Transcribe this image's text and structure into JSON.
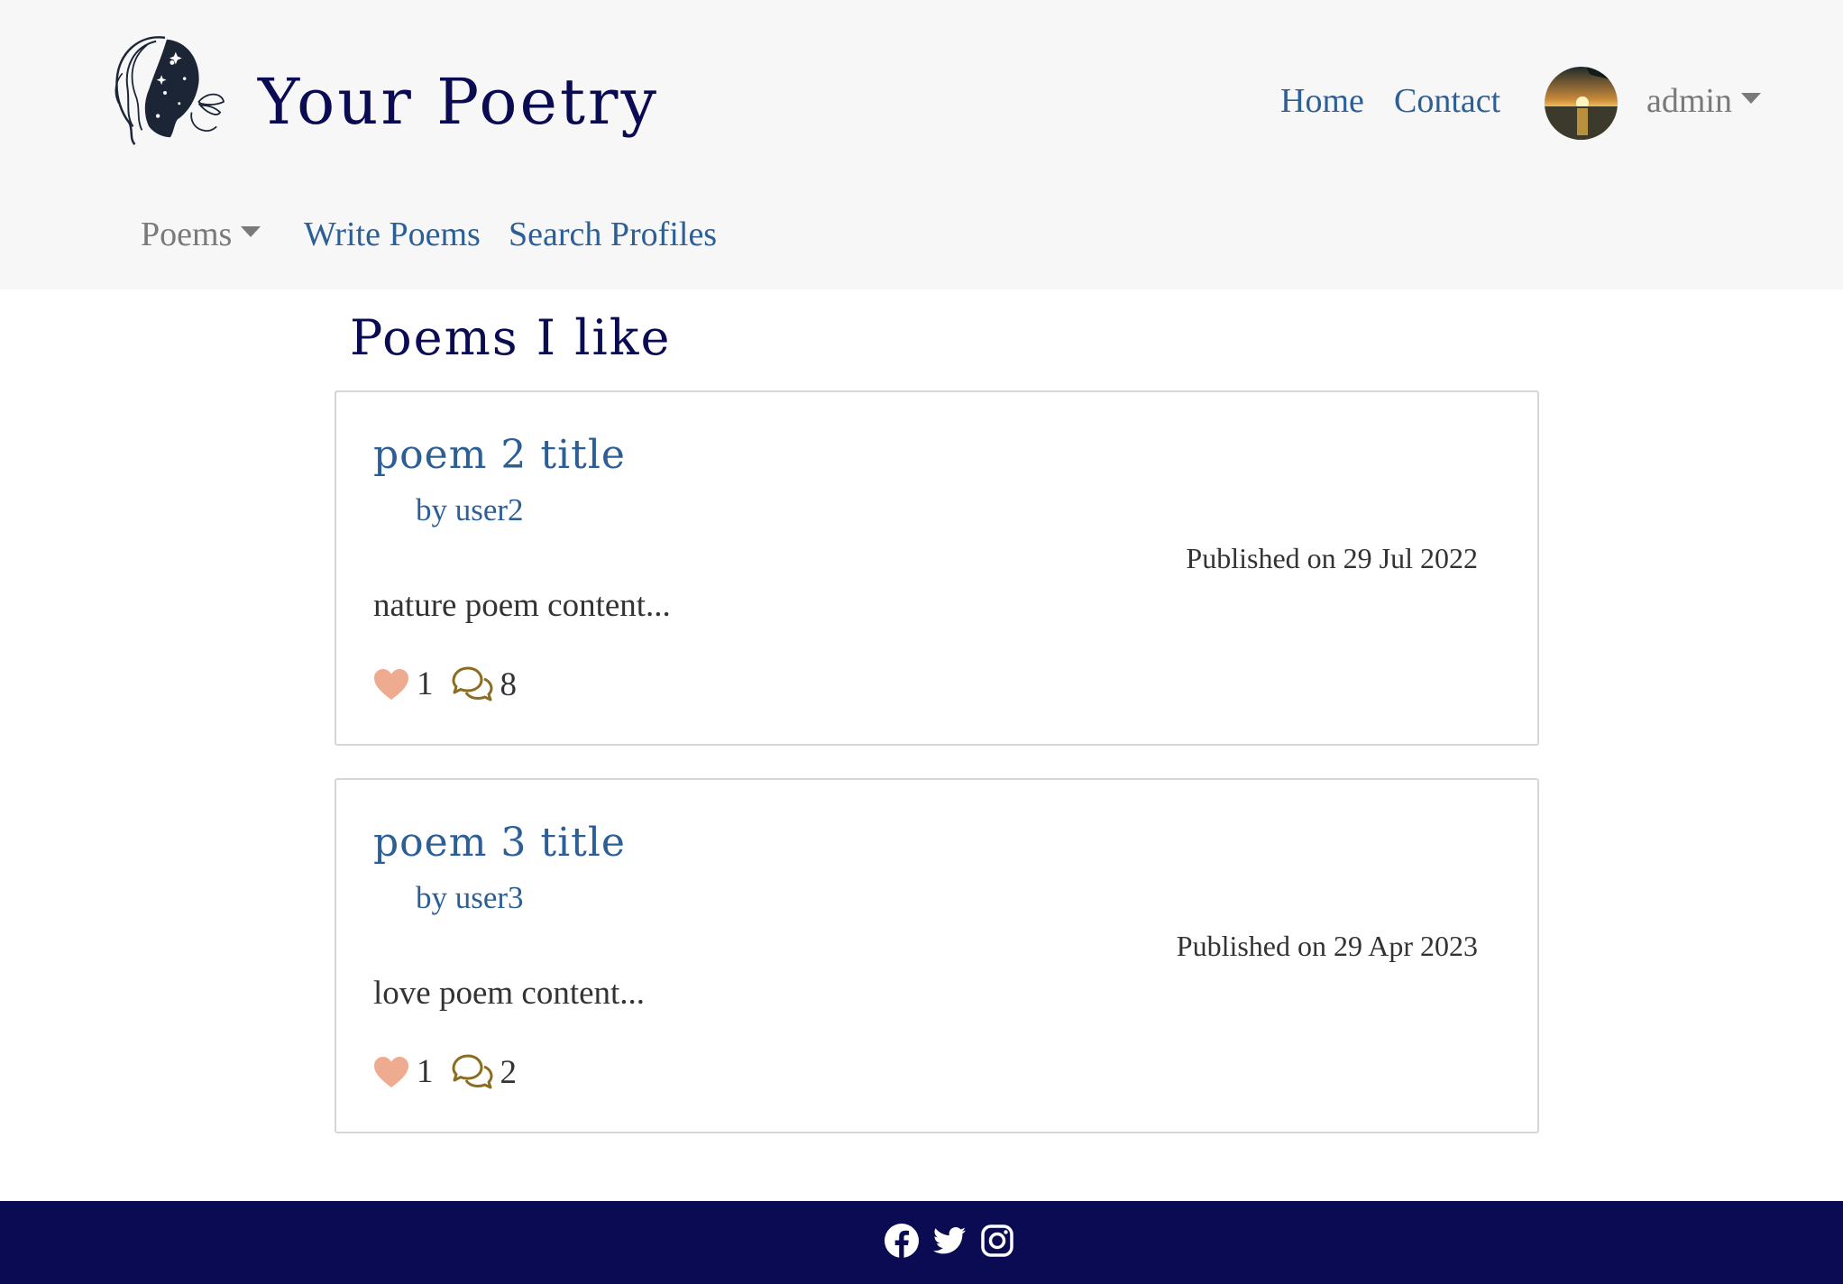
{
  "header": {
    "brand": "Your Poetry",
    "logo_icon": "poet-face-butterfly-logo",
    "nav": {
      "home": "Home",
      "contact": "Contact"
    },
    "user": {
      "name": "admin",
      "avatar_icon": "sunset-avatar"
    },
    "subnav": {
      "poems": "Poems",
      "write": "Write Poems",
      "search": "Search Profiles"
    }
  },
  "main": {
    "title": "Poems I like",
    "cards": [
      {
        "title": "poem 2 title",
        "author": "by user2",
        "date": "Published on 29 Jul 2022",
        "excerpt": "nature poem content...",
        "likes": "1",
        "comments": "8"
      },
      {
        "title": "poem 3 title",
        "author": "by user3",
        "date": "Published on 29 Apr 2023",
        "excerpt": "love poem content...",
        "likes": "1",
        "comments": "2"
      }
    ]
  },
  "footer": {
    "icons": [
      "facebook-icon",
      "twitter-icon",
      "instagram-icon"
    ]
  },
  "colors": {
    "brand": "#0a0b52",
    "link": "#2d5f97",
    "header_bg": "#f7f7f7",
    "footer_bg": "#0a0b52",
    "heart": "#eeab90",
    "comment": "#8a6d22"
  }
}
